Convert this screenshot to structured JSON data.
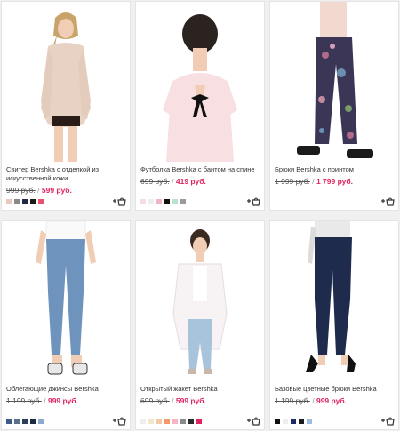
{
  "products": [
    {
      "name": "Свитер Bershka с отделкой из искусственной кожи",
      "old_price": "999 руб.",
      "separator": "/",
      "new_price": "599 руб.",
      "swatches": [
        "#e8c9bd",
        "#8a8a8a",
        "#1f2a44",
        "#1b1b1b",
        "#e8506b"
      ]
    },
    {
      "name": "Футболка Bershka с бантом на спине",
      "old_price": "699 руб.",
      "separator": "/",
      "new_price": "419 руб.",
      "swatches": [
        "#f6dde1",
        "#eeeeee",
        "#f3b4c3",
        "#111111",
        "#b7e3cc",
        "#9a9a9a"
      ]
    },
    {
      "name": "Брюки Bershka с принтом",
      "old_price": "1 999 руб.",
      "separator": "/",
      "new_price": "1 799 руб.",
      "swatches": []
    },
    {
      "name": "Облегающие джинсы Bershka",
      "old_price": "1 199 руб.",
      "separator": "/",
      "new_price": "999 руб.",
      "swatches": [
        "#3d5b86",
        "#5a6f88",
        "#2c3e5b",
        "#1d2a44",
        "#8aa9d0"
      ]
    },
    {
      "name": "Открытый жакет Bershka",
      "old_price": "699 руб.",
      "separator": "/",
      "new_price": "599 руб.",
      "swatches": [
        "#eeeeee",
        "#f1e6c9",
        "#f2c9a8",
        "#f39a6a",
        "#f7b6c4",
        "#8a8a8a",
        "#2b2b2b",
        "#e0245e"
      ]
    },
    {
      "name": "Базовые цветные брюки Bershka",
      "old_price": "1 199 руб.",
      "separator": "/",
      "new_price": "999 руб.",
      "swatches": [
        "#111111",
        "#eeeeee",
        "#1f2a66",
        "#1b1b1b",
        "#9bbbe0"
      ]
    }
  ],
  "add_to_cart_icon": "add-to-cart-bag-icon",
  "colors": {
    "accent": "#e0245e"
  }
}
